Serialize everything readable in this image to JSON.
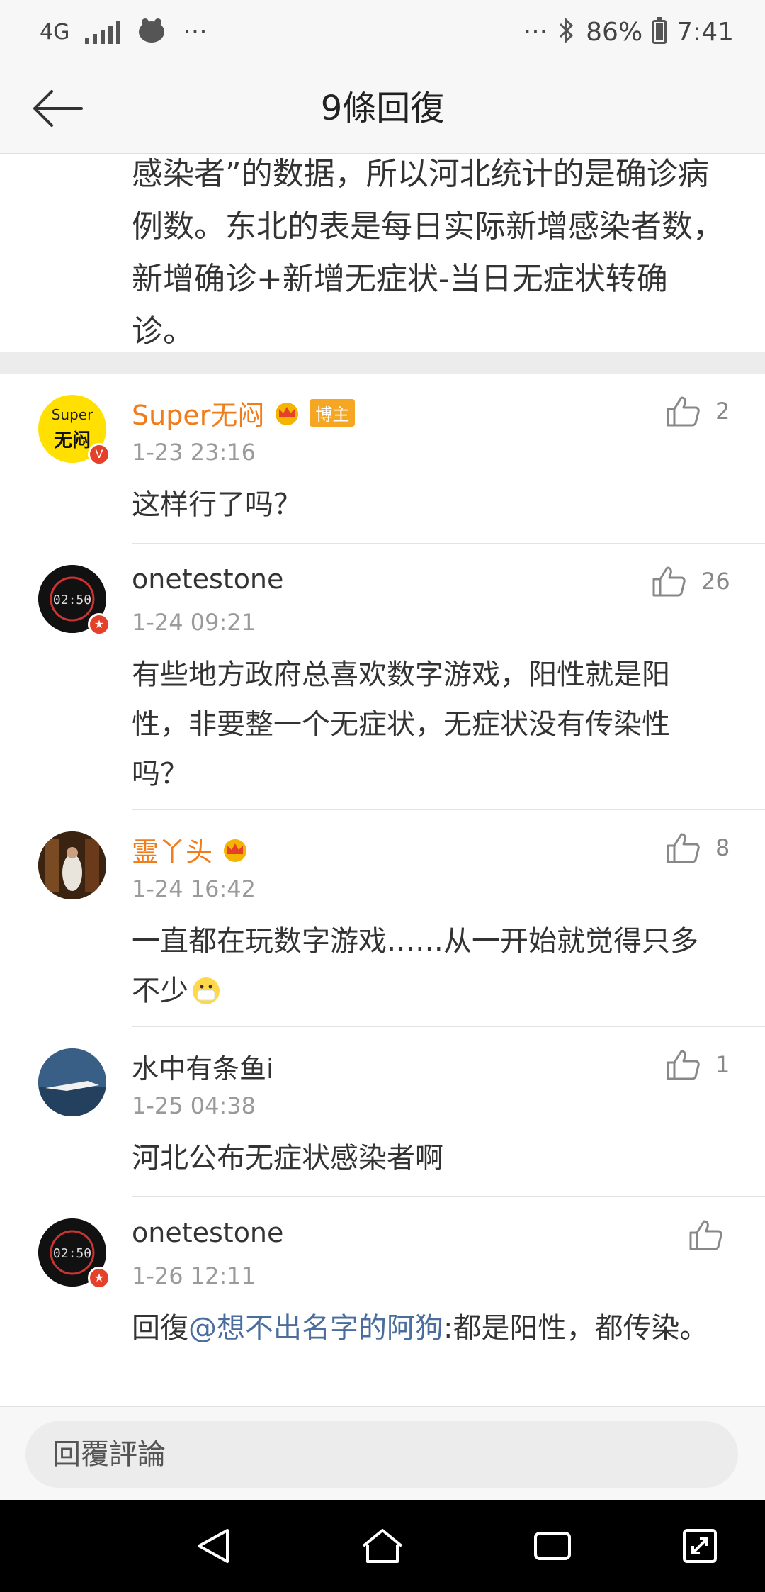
{
  "status_bar": {
    "network": "4G",
    "dots": "···",
    "battery": "86%",
    "battery_level": 0.86,
    "time": "7:41"
  },
  "header": {
    "title": "9條回復"
  },
  "previous_comment": {
    "text": "感染者”的数据，所以河北统计的是确诊病例数。东北的表是每日实际新增感染者数，新增确诊+新增无症状-当日无症状转确诊。"
  },
  "comments": [
    {
      "name": "Super无闷",
      "badge": "博主",
      "time": "1-23 23:16",
      "text": "这样行了吗？",
      "likes": "2",
      "avatar_text_top": "Super",
      "avatar_text_bottom": "无闷"
    },
    {
      "name": "onetestone",
      "time": "1-24 09:21",
      "text": "有些地方政府总喜欢数字游戏，阳性就是阳性，非要整一个无症状，无症状没有传染性吗？",
      "likes": "26"
    },
    {
      "name": "霊丫头",
      "time": "1-24 16:42",
      "text": "一直都在玩数字游戏……从一开始就觉得只多不少",
      "likes": "8"
    },
    {
      "name": "水中有条鱼i",
      "time": "1-25 04:38",
      "text": "河北公布无症状感染者啊",
      "likes": "1"
    },
    {
      "name": "onetestone",
      "time": "1-26 12:11",
      "reply_prefix": "回復",
      "mention": "@想不出名字的阿狗",
      "text": ":都是阳性，都传染。",
      "likes": ""
    }
  ],
  "reply_bar": {
    "placeholder": "回覆評論"
  },
  "colors": {
    "vip_name": "#f07c1c",
    "mention": "#4a6d9e",
    "badge_bg": "#f5a623",
    "verified_red": "#e5402a"
  }
}
